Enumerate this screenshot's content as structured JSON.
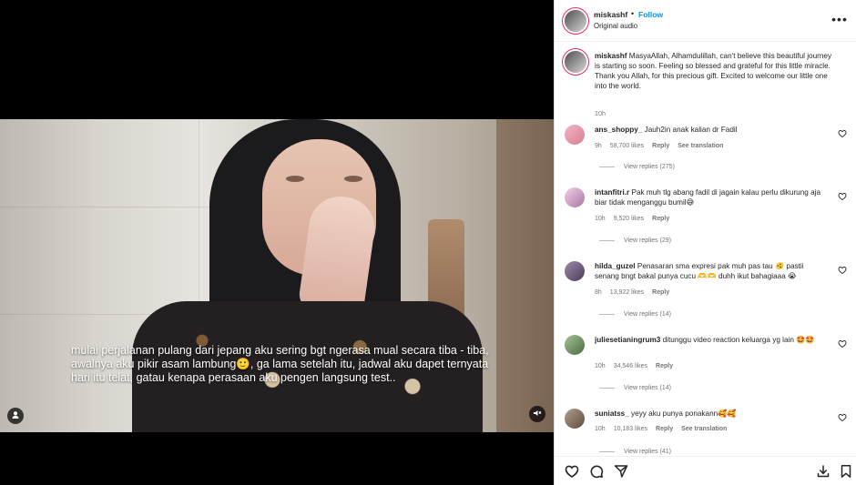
{
  "video": {
    "caption": "mulai perjalanan pulang dari jepang aku sering bgt ngerasa mual secara tiba - tiba, awalnya aku pikir asam lambung🙂, ga lama setelah itu, jadwal aku dapet ternyata hari itu telat, gatau kenapa perasaan aku pengen langsung test.."
  },
  "header": {
    "username": "miskashf",
    "separator": "•",
    "follow": "Follow",
    "audio": "Original audio",
    "more": "•••"
  },
  "post": {
    "username": "miskashf",
    "text": " MasyaAllah, Alhamdulillah, can't believe this beautiful journey is starting so soon. Feeling so blessed and grateful for this little miracle. Thank you Allah, for this precious gift. Excited to welcome our little one into the world.",
    "time": "10h"
  },
  "comments": [
    {
      "username": "ans_shoppy_",
      "text": " Jauh2in anak kalian dr Fadil",
      "time": "9h",
      "likes": "58,700 likes",
      "reply": "Reply",
      "translation": "See translation",
      "replies": "View replies (275)"
    },
    {
      "username": "intanfitri.r",
      "text": " Pak muh tlg abang fadil di jagain kalau perlu dikurung aja biar tidak menganggu bumil😅",
      "time": "10h",
      "likes": "9,520 likes",
      "reply": "Reply",
      "translation": "",
      "replies": "View replies (29)"
    },
    {
      "username": "hilda_guzel",
      "text": " Penasaran sma expresi pak muh pas tau 🫨 pastii senang bngt bakal punya cucu 🫶🫶 duhh ikut bahagiaaa 😭",
      "time": "8h",
      "likes": "13,922 likes",
      "reply": "Reply",
      "translation": "",
      "replies": "View replies (14)"
    },
    {
      "username": "juliesetianingrum3",
      "text": " ditunggu video reaction keluarga yg lain 🤩🤩",
      "time": "10h",
      "likes": "34,546 likes",
      "reply": "Reply",
      "translation": "",
      "replies": "View replies (14)"
    },
    {
      "username": "suniatss_",
      "text": " yeyy aku punya ponakann🥰🥰",
      "time": "10h",
      "likes": "10,183 likes",
      "reply": "Reply",
      "translation": "See translation",
      "replies": "View replies (41)"
    }
  ],
  "icons": {
    "user_tag": "user-icon",
    "mute": "mute-icon",
    "like": "heart-icon",
    "comment": "comment-icon",
    "share": "paper-plane-icon",
    "download": "download-icon",
    "save": "bookmark-icon"
  },
  "colors": {
    "link": "#0095f6",
    "muted_text": "#737373"
  }
}
